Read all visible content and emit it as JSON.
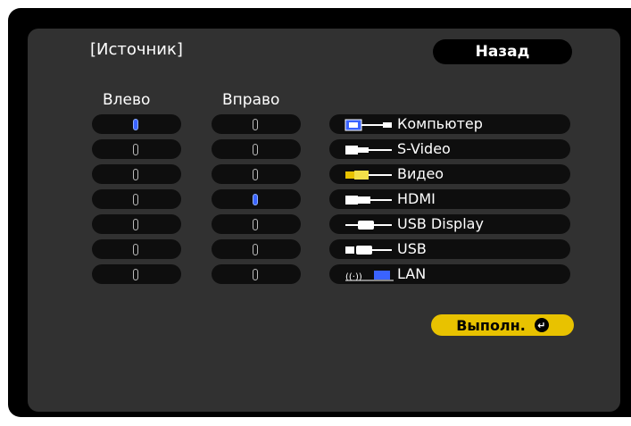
{
  "title": "[Источник]",
  "back_label": "Назад",
  "left_header": "Влево",
  "right_header": "Вправо",
  "sources": [
    {
      "label": "Компьютер",
      "icon": "computer-icon"
    },
    {
      "label": "S-Video",
      "icon": "svideo-icon"
    },
    {
      "label": "Видео",
      "icon": "video-icon"
    },
    {
      "label": "HDMI",
      "icon": "hdmi-icon"
    },
    {
      "label": "USB Display",
      "icon": "usb-display-icon"
    },
    {
      "label": "USB",
      "icon": "usb-icon"
    },
    {
      "label": "LAN",
      "icon": "lan-icon"
    }
  ],
  "left_selected_index": 0,
  "right_selected_index": 3,
  "execute_label": "Выполн.",
  "execute_icon": "enter-icon",
  "colors": {
    "background": "#313131",
    "selected": "#3a63ff",
    "execute": "#e8c200"
  }
}
